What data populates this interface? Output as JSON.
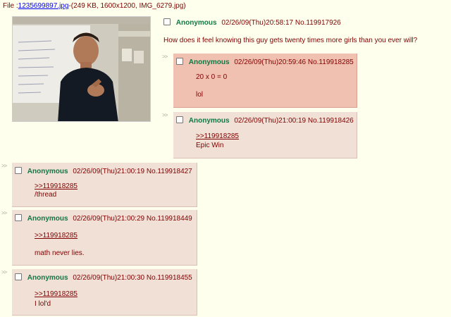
{
  "file": {
    "prefix": "File :",
    "link": "1235699897.jpg",
    "meta": "-(249 KB, 1600x1200, IMG_6279.jpg)"
  },
  "op": {
    "name": "Anonymous",
    "datetime": "02/26/09(Thu)20:58:17",
    "postno": "No.119917926",
    "comment": "How does it feel knowing this guy gets twenty times more girls than you ever will?"
  },
  "replies": [
    {
      "name": "Anonymous",
      "datetime": "02/26/09(Thu)20:59:46",
      "postno": "No.119918285",
      "lines": [
        "20 x 0 = 0",
        "lol"
      ],
      "highlighted": true
    },
    {
      "name": "Anonymous",
      "datetime": "02/26/09(Thu)21:00:19",
      "postno": "No.119918426",
      "quote": ">>119918285",
      "lines": [
        "Epic Win"
      ]
    },
    {
      "name": "Anonymous",
      "datetime": "02/26/09(Thu)21:00:19",
      "postno": "No.119918427",
      "quote": ">>119918285",
      "lines": [
        "/thread"
      ]
    },
    {
      "name": "Anonymous",
      "datetime": "02/26/09(Thu)21:00:29",
      "postno": "No.119918449",
      "quote": ">>119918285",
      "lines": [
        "math never lies."
      ]
    },
    {
      "name": "Anonymous",
      "datetime": "02/26/09(Thu)21:00:30",
      "postno": "No.119918455",
      "quote": ">>119918285",
      "lines": [
        "I lol'd"
      ]
    }
  ],
  "colors": {
    "background": "#ffffee",
    "reply_bg": "#f0e0d6",
    "highlight_bg": "#f0c0b0",
    "name": "#117743",
    "text": "#800000",
    "link": "#0000ee"
  }
}
